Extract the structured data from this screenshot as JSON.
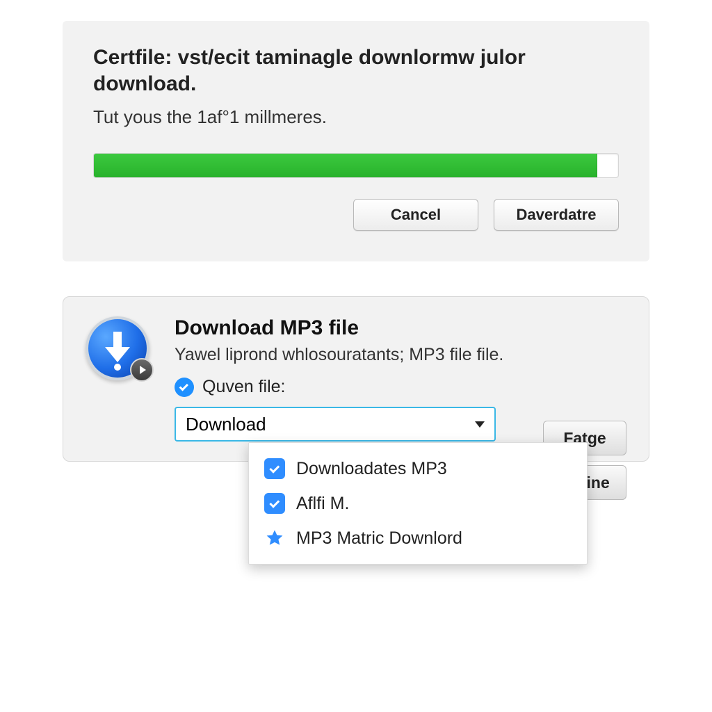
{
  "panel1": {
    "title": "Certfile: vst/ecit taminagle downlormw julor download.",
    "subtitle": "Tut yous the 1af°1 millmeres.",
    "progress_percent": 96,
    "buttons": {
      "cancel": "Cancel",
      "primary": "Daverdatre"
    }
  },
  "panel2": {
    "title": "Download MP3 file",
    "description": "Yawel liprond whlosouratants; MP3 file file.",
    "file_label": "Quven file:",
    "select_value": "Download",
    "buttons": {
      "fatge": "Fatge",
      "surine": "Surine"
    },
    "dropdown": [
      {
        "icon": "checkbox",
        "label": "Downloadates MP3"
      },
      {
        "icon": "checkbox",
        "label": "Aflfi M."
      },
      {
        "icon": "star",
        "label": "MP3 Matric Downlord"
      }
    ]
  }
}
